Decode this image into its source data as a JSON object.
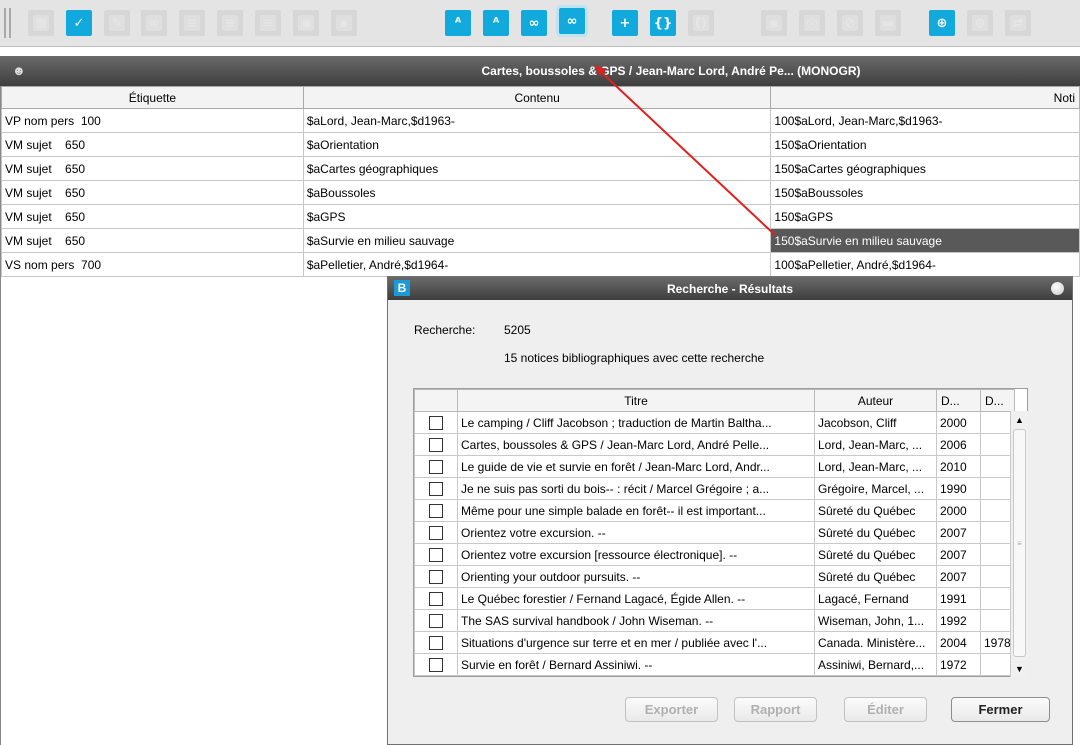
{
  "toolbar": {
    "buttons": [
      {
        "icon": "grid-icon",
        "state": "off",
        "glyph": "▦"
      },
      {
        "icon": "validate-record-icon",
        "state": "on",
        "glyph": "✓"
      },
      {
        "icon": "eraser-icon",
        "state": "off",
        "glyph": "✎"
      },
      {
        "icon": "binoculars-icon",
        "state": "off",
        "glyph": "∞"
      },
      {
        "icon": "list-icon",
        "state": "off",
        "glyph": "≡"
      },
      {
        "icon": "list-icon-2",
        "state": "off",
        "glyph": "≡"
      },
      {
        "icon": "list-icon-3",
        "state": "off",
        "glyph": "≡"
      },
      {
        "icon": "delete-doc-icon",
        "state": "off",
        "glyph": "▣"
      },
      {
        "icon": "save-icon",
        "state": "off",
        "glyph": "▪"
      },
      {
        "icon": "search-authority-icon",
        "state": "on",
        "glyph": "ᴬ"
      },
      {
        "icon": "search-authority-icon-2",
        "state": "on",
        "glyph": "ᴬ"
      },
      {
        "icon": "link-authority-icon",
        "state": "on",
        "glyph": "∞"
      },
      {
        "icon": "link-authority-active-icon",
        "state": "active",
        "glyph": "∞"
      },
      {
        "icon": "add-authority-icon",
        "state": "on",
        "glyph": "+"
      },
      {
        "icon": "authority-variants-icon",
        "state": "on",
        "glyph": "{}"
      },
      {
        "icon": "variants-disabled-icon",
        "state": "off",
        "glyph": "()"
      },
      {
        "icon": "save-disk-icon",
        "state": "off",
        "glyph": "▪"
      },
      {
        "icon": "circle-arrow-icon",
        "state": "off",
        "glyph": "◎"
      },
      {
        "icon": "cancel-icon",
        "state": "off",
        "glyph": "⊘"
      },
      {
        "icon": "keyboard-icon",
        "state": "off",
        "glyph": "▬"
      },
      {
        "icon": "globe-search-icon",
        "state": "on",
        "glyph": "⊕"
      },
      {
        "icon": "globe-icon",
        "state": "off",
        "glyph": "⊕"
      },
      {
        "icon": "swap-icon",
        "state": "off",
        "glyph": "⇄"
      }
    ]
  },
  "record": {
    "title": "Cartes, boussoles & GPS / Jean-Marc Lord, André Pe... (MONOGR)",
    "columns": [
      "Étiquette",
      "Contenu",
      "Noti"
    ],
    "rows": [
      {
        "label": "VP nom pers  100",
        "content": "$aLord, Jean-Marc,$d1963-",
        "notice": "100$aLord, Jean-Marc,$d1963-"
      },
      {
        "label": "VM sujet    650",
        "content": "$aOrientation",
        "notice": "150$aOrientation"
      },
      {
        "label": "VM sujet    650",
        "content": "$aCartes géographiques",
        "notice": "150$aCartes géographiques"
      },
      {
        "label": "VM sujet    650",
        "content": "$aBoussoles",
        "notice": "150$aBoussoles"
      },
      {
        "label": "VM sujet    650",
        "content": "$aGPS",
        "notice": "150$aGPS"
      },
      {
        "label": "VM sujet    650",
        "content": "$aSurvie en milieu sauvage",
        "notice": "150$aSurvie en milieu sauvage"
      },
      {
        "label": "VS nom pers  700",
        "content": "$aPelletier, André,$d1964-",
        "notice": "100$aPelletier, André,$d1964-"
      }
    ]
  },
  "dialog": {
    "title": "Recherche - Résultats",
    "search_label": "Recherche:",
    "search_value": "5205",
    "count_text": "15 notices bibliographiques avec cette recherche",
    "columns": [
      "",
      "Titre",
      "Auteur",
      "D...",
      "D..."
    ],
    "rows": [
      {
        "title": "Le camping / Cliff Jacobson ; traduction de Martin Baltha...",
        "author": "Jacobson, Cliff",
        "d1": "2000",
        "d2": ""
      },
      {
        "title": "Cartes, boussoles & GPS / Jean-Marc Lord, André Pelle...",
        "author": "Lord, Jean-Marc, ...",
        "d1": "2006",
        "d2": ""
      },
      {
        "title": "Le guide de vie et survie en forêt / Jean-Marc Lord, Andr...",
        "author": "Lord, Jean-Marc, ...",
        "d1": "2010",
        "d2": ""
      },
      {
        "title": "Je ne suis pas sorti du bois-- : récit / Marcel Grégoire ; a...",
        "author": "Grégoire, Marcel, ...",
        "d1": "1990",
        "d2": ""
      },
      {
        "title": "Même pour une simple balade en forêt-- il est important...",
        "author": "Sûreté du Québec",
        "d1": "2000",
        "d2": ""
      },
      {
        "title": "Orientez votre excursion. --",
        "author": "Sûreté du Québec",
        "d1": "2007",
        "d2": ""
      },
      {
        "title": "Orientez votre excursion [ressource électronique]. --",
        "author": "Sûreté du Québec",
        "d1": "2007",
        "d2": ""
      },
      {
        "title": "Orienting your outdoor pursuits. --",
        "author": "Sûreté du Québec",
        "d1": "2007",
        "d2": ""
      },
      {
        "title": "Le Québec forestier / Fernand Lagacé, Égide Allen. --",
        "author": "Lagacé, Fernand",
        "d1": "1991",
        "d2": ""
      },
      {
        "title": "The SAS survival handbook / John Wiseman. --",
        "author": "Wiseman, John, 1...",
        "d1": "1992",
        "d2": ""
      },
      {
        "title": "Situations d'urgence sur terre et en mer / publiée avec l'...",
        "author": "Canada. Ministère...",
        "d1": "2004",
        "d2": "1978"
      },
      {
        "title": "Survie en forêt / Bernard Assiniwi. --",
        "author": "Assiniwi, Bernard,...",
        "d1": "1972",
        "d2": ""
      }
    ],
    "buttons": {
      "export": "Exporter",
      "report": "Rapport",
      "edit": "Éditer",
      "close": "Fermer"
    }
  },
  "colors": {
    "accent": "#12a9dd",
    "titlebar": "#4a4a4a",
    "selected_row": "#595959",
    "annotation_arrow": "#e02020"
  }
}
